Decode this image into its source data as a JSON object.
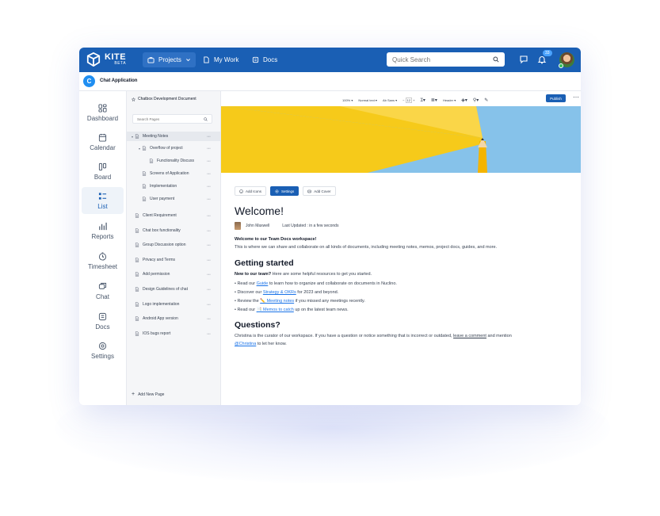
{
  "app": {
    "logo_name": "KITE",
    "logo_tag": "BETA",
    "nav": [
      {
        "label": "Projects",
        "icon": "briefcase-icon"
      },
      {
        "label": "My Work",
        "icon": "file-icon"
      },
      {
        "label": "Docs",
        "icon": "docs-icon"
      }
    ],
    "search_placeholder": "Quick Search",
    "notification_count": "33",
    "accent_color": "#1a5fb4"
  },
  "project": {
    "initial": "C",
    "name": "Chat Application"
  },
  "sidebar": {
    "items": [
      {
        "label": "Dashboard",
        "icon": "dashboard-icon"
      },
      {
        "label": "Calendar",
        "icon": "calendar-icon"
      },
      {
        "label": "Board",
        "icon": "board-icon"
      },
      {
        "label": "List",
        "icon": "list-icon",
        "active": true
      },
      {
        "label": "Reports",
        "icon": "reports-icon"
      },
      {
        "label": "Timesheet",
        "icon": "timesheet-icon"
      },
      {
        "label": "Chat",
        "icon": "chat-icon"
      },
      {
        "label": "Docs",
        "icon": "docs-icon"
      },
      {
        "label": "Settings",
        "icon": "settings-icon"
      }
    ]
  },
  "pages": {
    "search_placeholder": "Search Pages",
    "items": [
      {
        "label": "Meeting Notes",
        "level": 0,
        "expanded": true,
        "selected": true
      },
      {
        "label": "Overflow of project",
        "level": 1,
        "expanded": true
      },
      {
        "label": "Functionality Discuss",
        "level": 2
      },
      {
        "label": "Screens of Application",
        "level": 1
      },
      {
        "label": "Implementation",
        "level": 1
      },
      {
        "label": "User payment",
        "level": 1
      },
      {
        "label": "Client Requirement",
        "level": 0
      },
      {
        "label": "Chat box functionality",
        "level": 0
      },
      {
        "label": "Group Discussion option",
        "level": 0
      },
      {
        "label": "Privacy and Terms",
        "level": 0
      },
      {
        "label": "Add permission",
        "level": 0
      },
      {
        "label": "Design Guidelines of chat",
        "level": 0
      },
      {
        "label": "Logo implementation",
        "level": 0
      },
      {
        "label": "Android App version",
        "level": 0
      },
      {
        "label": "IOS bugs report",
        "level": 0
      }
    ],
    "add_label": "Add New Page"
  },
  "editor": {
    "doc_title": "Chatbox Development Document",
    "toolbar": {
      "zoom": "100%",
      "style": "Normal text",
      "font": "Ab Sans",
      "font_size": "12",
      "heading": "Header"
    },
    "publish_label": "Publish"
  },
  "document": {
    "chips": [
      {
        "label": "Add Icons",
        "icon": "emoji-icon"
      },
      {
        "label": "Settings",
        "icon": "gear-icon",
        "primary": true
      },
      {
        "label": "Add Cover",
        "icon": "image-icon"
      }
    ],
    "title": "Welcome!",
    "author": "John Maxwell",
    "updated": "Last Updated : in a few seconds",
    "intro_title": "Welcome to our Team Docs workspace!",
    "intro_text": "This is where we can share and collaborate on all kinds of documents, including meeting notes, memos, project docs, guides, and more.",
    "getting_started": {
      "heading": "Getting started",
      "lead_bold": "New to our team?",
      "lead_rest": " Here are some helpful resources to get you started.",
      "bullets": [
        {
          "pre": "• Read our ",
          "link": "Guide",
          "post": " to learn how to organize and collaborate on documents in Nuclino."
        },
        {
          "pre": "• Discover our ",
          "link": "Strategy & OKRs",
          "post": " for 2023 and beyond."
        },
        {
          "pre": "• Review the ",
          "link": "✏️ Meeting notes",
          "post": " if you missed any meetings recently."
        },
        {
          "pre": "• Read our ",
          "link": "📑 Memos to catch",
          "post": " up on the latest team news."
        }
      ]
    },
    "questions": {
      "heading": "Questions?",
      "line1_pre": "Christina is the curator of our workspace. If you have a question or notice something that is incorrect or outdated, ",
      "line1_link": "leave a comment",
      "line1_post": " and mention",
      "line2_link": "@Christina",
      "line2_post": " to let her know."
    }
  }
}
